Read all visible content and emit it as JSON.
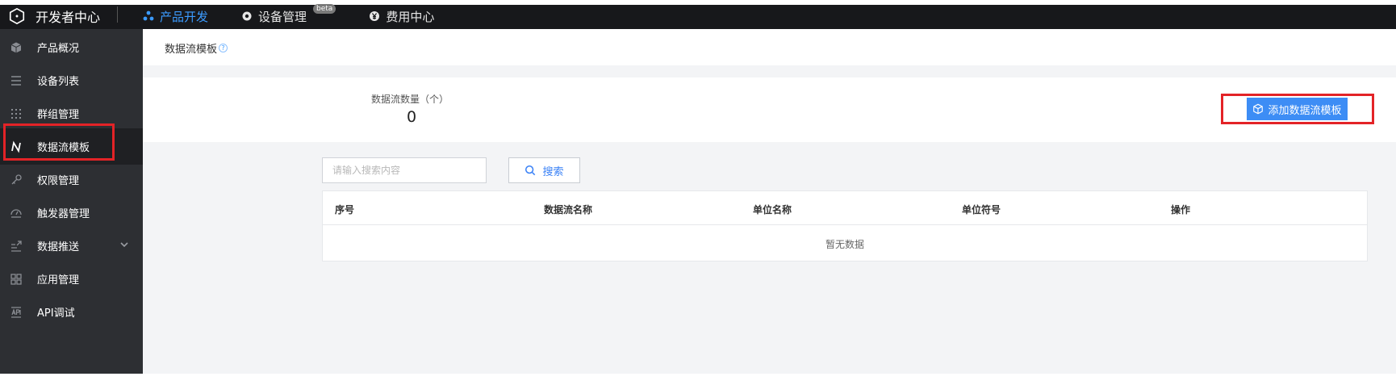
{
  "topbar": {
    "brand": "开发者中心",
    "nav": [
      {
        "label": "产品开发",
        "icon": "cluster-icon",
        "active": true
      },
      {
        "label": "设备管理",
        "icon": "gear-icon",
        "badge": "beta"
      },
      {
        "label": "费用中心",
        "icon": "yen-icon"
      }
    ]
  },
  "sidebar": {
    "items": [
      {
        "label": "产品概况",
        "icon": "cube-icon"
      },
      {
        "label": "设备列表",
        "icon": "list-icon"
      },
      {
        "label": "群组管理",
        "icon": "grid-dots-icon"
      },
      {
        "label": "数据流模板",
        "icon": "datastream-icon",
        "active": true
      },
      {
        "label": "权限管理",
        "icon": "key-icon"
      },
      {
        "label": "触发器管理",
        "icon": "gauge-icon"
      },
      {
        "label": "数据推送",
        "icon": "push-icon",
        "expandable": true
      },
      {
        "label": "应用管理",
        "icon": "apps-icon"
      },
      {
        "label": "API调试",
        "icon": "api-icon"
      }
    ]
  },
  "main": {
    "title": "数据流模板",
    "help": "?",
    "stat_label": "数据流数量（个）",
    "stat_value": "0",
    "add_button": "添加数据流模板",
    "search": {
      "placeholder": "请输入搜索内容",
      "button": "搜索"
    },
    "table": {
      "columns": [
        "序号",
        "数据流名称",
        "单位名称",
        "单位符号",
        "操作"
      ],
      "empty_text": "暂无数据"
    }
  },
  "colors": {
    "topbar": "#17181b",
    "sidebar": "#2d2f33",
    "accent": "#3d8df5",
    "highlight": "#e32327"
  }
}
